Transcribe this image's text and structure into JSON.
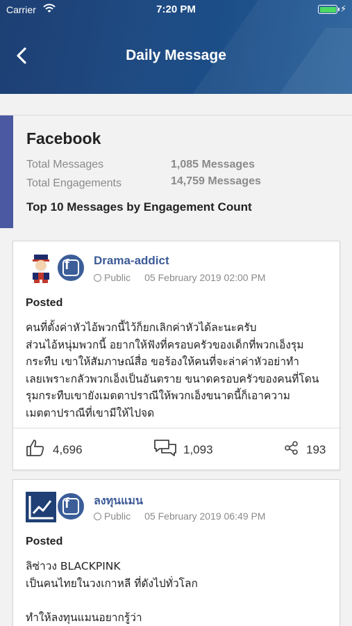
{
  "status_bar": {
    "carrier": "Carrier",
    "time": "7:20 PM"
  },
  "header": {
    "title": "Daily Message"
  },
  "summary": {
    "platform": "Facebook",
    "rows": [
      {
        "label": "Total Messages",
        "value": "1,085 Messages"
      },
      {
        "label": "Total Engagements",
        "value": "14,759 Messages"
      }
    ],
    "section_title": "Top 10 Messages by Engagement Count"
  },
  "posts": [
    {
      "author": "Drama-addict",
      "visibility": "Public",
      "date": "05 February 2019 02:00 PM",
      "type": "Posted",
      "text": "คนที่ตั้งค่าหัวไอ้พวกนี้ไว้ก็ยกเลิกค่าหัวได้ละนะครับ\nส่วนไอ้หนุ่มพวกนี้ อยากให้ฟังที่ครอบครัวของเด็กที่พวกเอ็งรุม\nกระทืบ เขาให้สัมภาษณ์สื่อ ขอร้องให้คนที่จะล่าค่าหัวอย่าทำ\nเลยเพราะกลัวพวกเอ็งเป็นอันตราย ขนาดครอบครัวของคนที่โดน\nรุมกระทืบเขายังเมตตาปราณีให้พวกเอ็งขนาดนี้ก็เอาความ\nเมตตาปราณีที่เขามีให้ไปจด",
      "likes": "4,696",
      "comments": "1,093",
      "shares": "193",
      "avatar_icon": "cartoon-avatar-icon"
    },
    {
      "author": "ลงทุนแมน",
      "visibility": "Public",
      "date": "05 February 2019 06:49 PM",
      "type": "Posted",
      "text": "ลิซ่าวง BLACKPINK\nเป็นคนไทยในวงเกาหลี ที่ดังไปทั่วโลก\n\nทำให้ลงทุนแมนอยากรู้ว่า",
      "avatar_icon": "chart-avatar-icon"
    }
  ],
  "colors": {
    "header": "#1f4c84",
    "accent_bar": "#4a59a1",
    "author": "#3c5a96",
    "facebook": "#3b5e99"
  }
}
